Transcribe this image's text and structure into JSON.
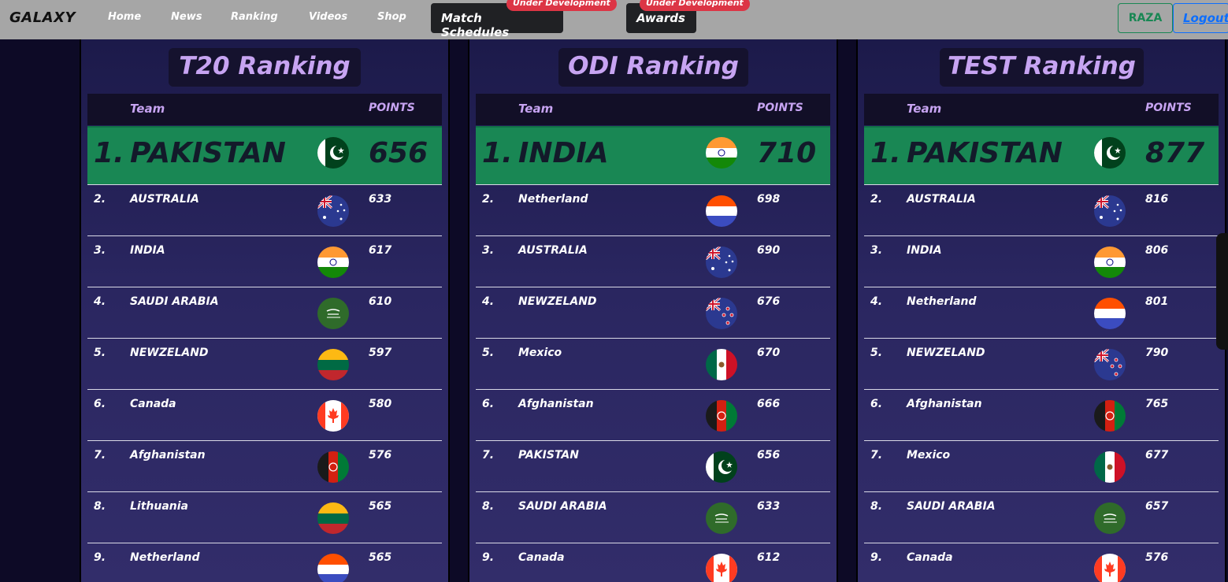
{
  "nav": {
    "brand": "GALAXY",
    "links": [
      "Home",
      "News",
      "Ranking",
      "Videos",
      "Shop"
    ],
    "match_schedules": "Match Schedules",
    "awards": "Awards",
    "badge": "Under Development",
    "user": "RAZA",
    "logout": "Logout"
  },
  "tables": [
    {
      "title": "T20 Ranking",
      "header_team": "Team",
      "header_points": "POINTS",
      "top": {
        "rank": "1.",
        "name": "PAKISTAN",
        "flag": "pakistan-flag-icon",
        "points": "656"
      },
      "rows": [
        {
          "rank": "2.",
          "name": "AUSTRALIA",
          "flag": "australia-flag-icon",
          "points": "633"
        },
        {
          "rank": "3.",
          "name": "INDIA",
          "flag": "india-flag-icon",
          "points": "617"
        },
        {
          "rank": "4.",
          "name": "SAUDI ARABIA",
          "flag": "saudi-arabia-flag-icon",
          "points": "610"
        },
        {
          "rank": "5.",
          "name": "NEWZELAND",
          "flag": "lithuania-flag-icon",
          "points": "597"
        },
        {
          "rank": "6.",
          "name": "Canada",
          "flag": "canada-flag-icon",
          "points": "580"
        },
        {
          "rank": "7.",
          "name": "Afghanistan",
          "flag": "afghanistan-flag-icon",
          "points": "576"
        },
        {
          "rank": "8.",
          "name": "Lithuania",
          "flag": "lithuania-flag-icon",
          "points": "565"
        },
        {
          "rank": "9.",
          "name": "Netherland",
          "flag": "netherlands-flag-icon",
          "points": "565"
        }
      ]
    },
    {
      "title": "ODI Ranking",
      "header_team": "Team",
      "header_points": "POINTS",
      "top": {
        "rank": "1.",
        "name": "INDIA",
        "flag": "india-flag-icon",
        "points": "710"
      },
      "rows": [
        {
          "rank": "2.",
          "name": "Netherland",
          "flag": "netherlands-flag-icon",
          "points": "698"
        },
        {
          "rank": "3.",
          "name": "AUSTRALIA",
          "flag": "australia-flag-icon",
          "points": "690"
        },
        {
          "rank": "4.",
          "name": "NEWZELAND",
          "flag": "new-zealand-flag-icon",
          "points": "676"
        },
        {
          "rank": "5.",
          "name": "Mexico",
          "flag": "mexico-flag-icon",
          "points": "670"
        },
        {
          "rank": "6.",
          "name": "Afghanistan",
          "flag": "afghanistan-flag-icon",
          "points": "666"
        },
        {
          "rank": "7.",
          "name": "PAKISTAN",
          "flag": "pakistan-flag-icon",
          "points": "656"
        },
        {
          "rank": "8.",
          "name": "SAUDI ARABIA",
          "flag": "saudi-arabia-flag-icon",
          "points": "633"
        },
        {
          "rank": "9.",
          "name": "Canada",
          "flag": "canada-flag-icon",
          "points": "612"
        }
      ]
    },
    {
      "title": "TEST Ranking",
      "header_team": "Team",
      "header_points": "POINTS",
      "top": {
        "rank": "1.",
        "name": "PAKISTAN",
        "flag": "pakistan-flag-icon",
        "points": "877"
      },
      "rows": [
        {
          "rank": "2.",
          "name": "AUSTRALIA",
          "flag": "australia-flag-icon",
          "points": "816"
        },
        {
          "rank": "3.",
          "name": "INDIA",
          "flag": "india-flag-icon",
          "points": "806"
        },
        {
          "rank": "4.",
          "name": "Netherland",
          "flag": "netherlands-flag-icon",
          "points": "801"
        },
        {
          "rank": "5.",
          "name": "NEWZELAND",
          "flag": "new-zealand-flag-icon",
          "points": "790"
        },
        {
          "rank": "6.",
          "name": "Afghanistan",
          "flag": "afghanistan-flag-icon",
          "points": "765"
        },
        {
          "rank": "7.",
          "name": "Mexico",
          "flag": "mexico-flag-icon",
          "points": "677"
        },
        {
          "rank": "8.",
          "name": "SAUDI ARABIA",
          "flag": "saudi-arabia-flag-icon",
          "points": "657"
        },
        {
          "rank": "9.",
          "name": "Canada",
          "flag": "canada-flag-icon",
          "points": "576"
        }
      ]
    }
  ],
  "colors": {
    "accent_purple": "#c7a4f2",
    "top_row_green": "#198754",
    "badge_red": "#dc3545"
  }
}
